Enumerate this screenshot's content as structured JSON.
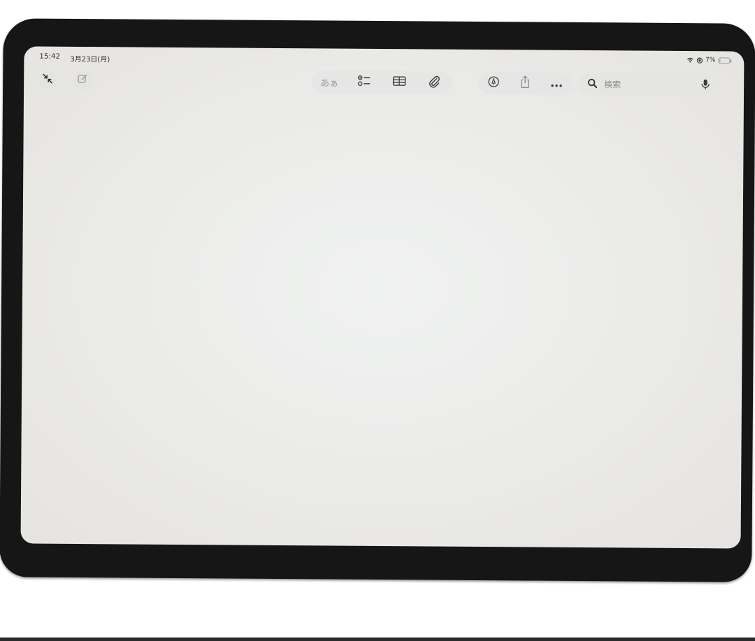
{
  "status_bar": {
    "time": "15:42",
    "date": "3月23日(月)",
    "battery_text": "7%",
    "battery_level": 0.07
  },
  "toolbar": {
    "left": [
      {
        "icon": "collapse-arrows-icon"
      },
      {
        "icon": "compose-icon"
      }
    ],
    "format_label": "あぁ",
    "format_group": [
      "format-text-icon",
      "checklist-icon",
      "table-icon",
      "paperclip-icon"
    ],
    "action_group": [
      "markup-pen-icon",
      "share-icon",
      "more-icon"
    ],
    "search": {
      "placeholder": "検索",
      "icon": "search-icon",
      "mic_icon": "microphone-icon"
    }
  },
  "colors": {
    "bezel": "#161616",
    "screen": "#eceeec",
    "icon": "#3a3a3a",
    "icon_muted": "#9a9a9a"
  }
}
